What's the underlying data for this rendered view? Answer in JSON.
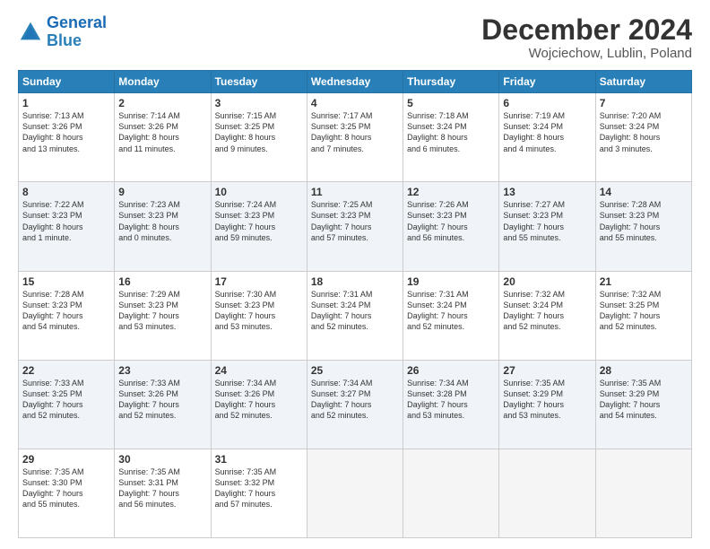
{
  "header": {
    "logo_line1": "General",
    "logo_line2": "Blue",
    "month": "December 2024",
    "location": "Wojciechow, Lublin, Poland"
  },
  "weekdays": [
    "Sunday",
    "Monday",
    "Tuesday",
    "Wednesday",
    "Thursday",
    "Friday",
    "Saturday"
  ],
  "weeks": [
    [
      {
        "day": "1",
        "info": "Sunrise: 7:13 AM\nSunset: 3:26 PM\nDaylight: 8 hours\nand 13 minutes."
      },
      {
        "day": "2",
        "info": "Sunrise: 7:14 AM\nSunset: 3:26 PM\nDaylight: 8 hours\nand 11 minutes."
      },
      {
        "day": "3",
        "info": "Sunrise: 7:15 AM\nSunset: 3:25 PM\nDaylight: 8 hours\nand 9 minutes."
      },
      {
        "day": "4",
        "info": "Sunrise: 7:17 AM\nSunset: 3:25 PM\nDaylight: 8 hours\nand 7 minutes."
      },
      {
        "day": "5",
        "info": "Sunrise: 7:18 AM\nSunset: 3:24 PM\nDaylight: 8 hours\nand 6 minutes."
      },
      {
        "day": "6",
        "info": "Sunrise: 7:19 AM\nSunset: 3:24 PM\nDaylight: 8 hours\nand 4 minutes."
      },
      {
        "day": "7",
        "info": "Sunrise: 7:20 AM\nSunset: 3:24 PM\nDaylight: 8 hours\nand 3 minutes."
      }
    ],
    [
      {
        "day": "8",
        "info": "Sunrise: 7:22 AM\nSunset: 3:23 PM\nDaylight: 8 hours\nand 1 minute."
      },
      {
        "day": "9",
        "info": "Sunrise: 7:23 AM\nSunset: 3:23 PM\nDaylight: 8 hours\nand 0 minutes."
      },
      {
        "day": "10",
        "info": "Sunrise: 7:24 AM\nSunset: 3:23 PM\nDaylight: 7 hours\nand 59 minutes."
      },
      {
        "day": "11",
        "info": "Sunrise: 7:25 AM\nSunset: 3:23 PM\nDaylight: 7 hours\nand 57 minutes."
      },
      {
        "day": "12",
        "info": "Sunrise: 7:26 AM\nSunset: 3:23 PM\nDaylight: 7 hours\nand 56 minutes."
      },
      {
        "day": "13",
        "info": "Sunrise: 7:27 AM\nSunset: 3:23 PM\nDaylight: 7 hours\nand 55 minutes."
      },
      {
        "day": "14",
        "info": "Sunrise: 7:28 AM\nSunset: 3:23 PM\nDaylight: 7 hours\nand 55 minutes."
      }
    ],
    [
      {
        "day": "15",
        "info": "Sunrise: 7:28 AM\nSunset: 3:23 PM\nDaylight: 7 hours\nand 54 minutes."
      },
      {
        "day": "16",
        "info": "Sunrise: 7:29 AM\nSunset: 3:23 PM\nDaylight: 7 hours\nand 53 minutes."
      },
      {
        "day": "17",
        "info": "Sunrise: 7:30 AM\nSunset: 3:23 PM\nDaylight: 7 hours\nand 53 minutes."
      },
      {
        "day": "18",
        "info": "Sunrise: 7:31 AM\nSunset: 3:24 PM\nDaylight: 7 hours\nand 52 minutes."
      },
      {
        "day": "19",
        "info": "Sunrise: 7:31 AM\nSunset: 3:24 PM\nDaylight: 7 hours\nand 52 minutes."
      },
      {
        "day": "20",
        "info": "Sunrise: 7:32 AM\nSunset: 3:24 PM\nDaylight: 7 hours\nand 52 minutes."
      },
      {
        "day": "21",
        "info": "Sunrise: 7:32 AM\nSunset: 3:25 PM\nDaylight: 7 hours\nand 52 minutes."
      }
    ],
    [
      {
        "day": "22",
        "info": "Sunrise: 7:33 AM\nSunset: 3:25 PM\nDaylight: 7 hours\nand 52 minutes."
      },
      {
        "day": "23",
        "info": "Sunrise: 7:33 AM\nSunset: 3:26 PM\nDaylight: 7 hours\nand 52 minutes."
      },
      {
        "day": "24",
        "info": "Sunrise: 7:34 AM\nSunset: 3:26 PM\nDaylight: 7 hours\nand 52 minutes."
      },
      {
        "day": "25",
        "info": "Sunrise: 7:34 AM\nSunset: 3:27 PM\nDaylight: 7 hours\nand 52 minutes."
      },
      {
        "day": "26",
        "info": "Sunrise: 7:34 AM\nSunset: 3:28 PM\nDaylight: 7 hours\nand 53 minutes."
      },
      {
        "day": "27",
        "info": "Sunrise: 7:35 AM\nSunset: 3:29 PM\nDaylight: 7 hours\nand 53 minutes."
      },
      {
        "day": "28",
        "info": "Sunrise: 7:35 AM\nSunset: 3:29 PM\nDaylight: 7 hours\nand 54 minutes."
      }
    ],
    [
      {
        "day": "29",
        "info": "Sunrise: 7:35 AM\nSunset: 3:30 PM\nDaylight: 7 hours\nand 55 minutes."
      },
      {
        "day": "30",
        "info": "Sunrise: 7:35 AM\nSunset: 3:31 PM\nDaylight: 7 hours\nand 56 minutes."
      },
      {
        "day": "31",
        "info": "Sunrise: 7:35 AM\nSunset: 3:32 PM\nDaylight: 7 hours\nand 57 minutes."
      },
      null,
      null,
      null,
      null
    ]
  ]
}
